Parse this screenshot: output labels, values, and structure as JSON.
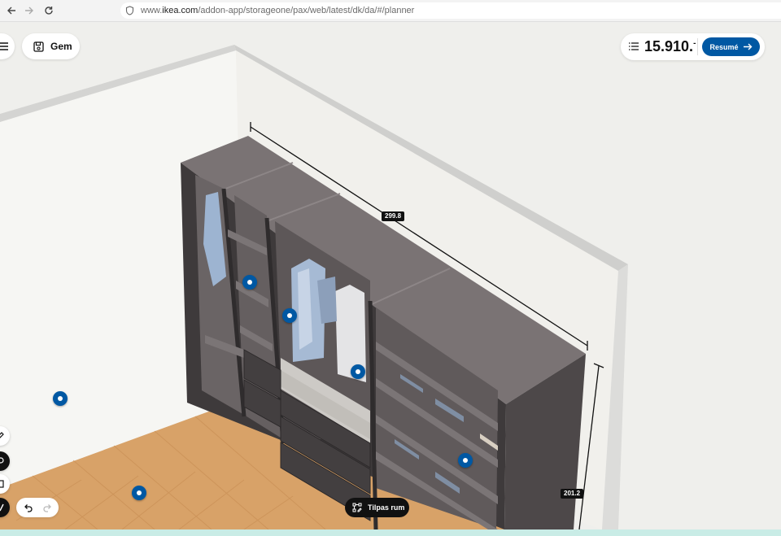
{
  "browser": {
    "url_prefix": "www.",
    "url_domain": "ikea.com",
    "url_path": "/addon-app/storageone/pax/web/latest/dk/da/#/planner"
  },
  "toolbar": {
    "save_label": "Gem",
    "price_value": "15.910.",
    "price_suffix": "-",
    "resume_label": "Resumé"
  },
  "dimensions": {
    "width_label": "299.8",
    "height_label": "201.2"
  },
  "bottom": {
    "customize_room_label": "Tilpas rum"
  },
  "colors": {
    "accent": "#0058a3",
    "wardrobe": "#5e5859",
    "floor": "#d9a56a",
    "wall": "#eeeeea"
  },
  "icons": [
    "back-arrow-icon",
    "forward-arrow-icon",
    "reload-icon",
    "shield-icon",
    "menu-icon",
    "save-icon",
    "list-icon",
    "arrow-right-icon",
    "undo-icon",
    "redo-icon",
    "room-edit-icon"
  ]
}
